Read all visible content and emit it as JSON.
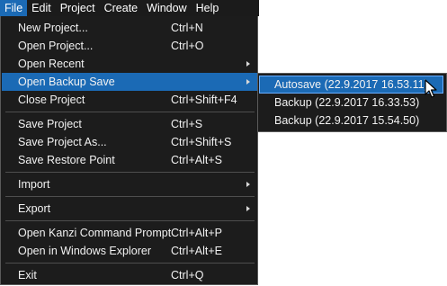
{
  "menubar": {
    "items": [
      {
        "label": "File"
      },
      {
        "label": "Edit"
      },
      {
        "label": "Project"
      },
      {
        "label": "Create"
      },
      {
        "label": "Window"
      },
      {
        "label": "Help"
      }
    ]
  },
  "file_menu": {
    "items": [
      {
        "label": "New Project...",
        "shortcut": "Ctrl+N"
      },
      {
        "label": "Open Project...",
        "shortcut": "Ctrl+O"
      },
      {
        "label": "Open Recent",
        "shortcut": ""
      },
      {
        "label": "Open Backup Save",
        "shortcut": ""
      },
      {
        "label": "Close Project",
        "shortcut": "Ctrl+Shift+F4"
      },
      {
        "label": "Save Project",
        "shortcut": "Ctrl+S"
      },
      {
        "label": "Save Project As...",
        "shortcut": "Ctrl+Shift+S"
      },
      {
        "label": "Save Restore Point",
        "shortcut": "Ctrl+Alt+S"
      },
      {
        "label": "Import",
        "shortcut": ""
      },
      {
        "label": "Export",
        "shortcut": ""
      },
      {
        "label": "Open Kanzi Command Prompt",
        "shortcut": "Ctrl+Alt+P"
      },
      {
        "label": "Open in Windows Explorer",
        "shortcut": "Ctrl+Alt+E"
      },
      {
        "label": "Exit",
        "shortcut": "Ctrl+Q"
      }
    ]
  },
  "backup_submenu": {
    "items": [
      {
        "label": "Autosave (22.9.2017 16.53.11)"
      },
      {
        "label": "Backup (22.9.2017 16.33.53)"
      },
      {
        "label": "Backup (22.9.2017 15.54.50)"
      }
    ]
  },
  "icons": {
    "submenu_arrow": "chevron-right-icon",
    "cursor": "mouse-pointer-icon"
  },
  "colors": {
    "menu_background": "#1c1c1c",
    "highlight": "#1b6ab5",
    "border": "#5a5a5a",
    "text": "#f2f2f2"
  }
}
